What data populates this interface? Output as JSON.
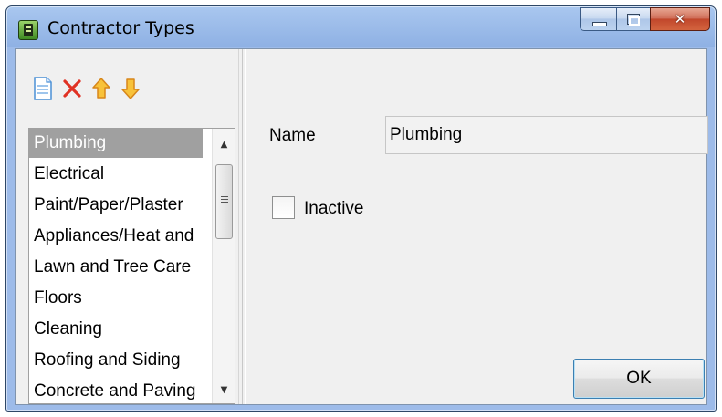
{
  "window": {
    "title": "Contractor Types"
  },
  "titlebar_buttons": {
    "minimize_icon": "minimize-icon",
    "maximize_icon": "maximize-icon",
    "close_icon": "close-icon"
  },
  "toolbar": {
    "new_icon": "new-document-icon",
    "delete_icon": "delete-x-icon",
    "move_up_icon": "arrow-up-icon",
    "move_down_icon": "arrow-down-icon"
  },
  "list": {
    "items": [
      "Plumbing",
      "Electrical",
      "Paint/Paper/Plaster",
      "Appliances/Heat and",
      "Lawn and Tree Care",
      "Floors",
      "Cleaning",
      "Roofing and Siding",
      "Concrete and Paving"
    ],
    "selected": "Plumbing"
  },
  "form": {
    "name_label": "Name",
    "name_value": "Plumbing",
    "inactive_label": "Inactive",
    "inactive_checked": false,
    "ok_label": "OK"
  },
  "colors": {
    "title_bar": "#8fb1e4",
    "selection": "#a0a0a0",
    "close_button": "#c1472b",
    "new_icon": "#4a8fd6",
    "delete_icon": "#e03224",
    "arrow_icon": "#f5a623"
  }
}
